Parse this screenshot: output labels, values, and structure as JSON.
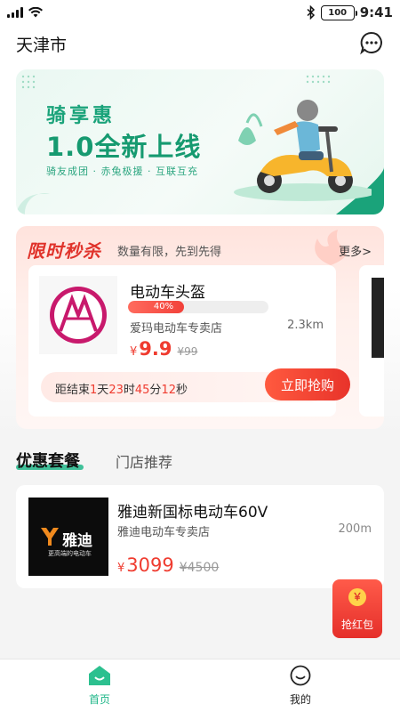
{
  "status_bar": {
    "time": "9:41",
    "battery": "100"
  },
  "header": {
    "city": "天津市"
  },
  "banner": {
    "title": "骑享惠",
    "headline": "1.0全新上线",
    "subtitle": "骑友成团 · 赤兔极援 · 互联互充"
  },
  "flash_sale": {
    "title": "限时秒杀",
    "subtitle": "数量有限，先到先得",
    "more": "更多>",
    "product": {
      "name": "电动车头盔",
      "progress_label": "40%",
      "progress": 0.4,
      "store": "爱玛电动车专卖店",
      "distance": "2.3km",
      "currency": "¥",
      "price": "9.9",
      "old_price": "¥99"
    },
    "countdown": {
      "prefix": "距结束",
      "days": "1",
      "days_unit": "天",
      "hours": "23",
      "hours_unit": "时",
      "minutes": "45",
      "minutes_unit": "分",
      "seconds": "12",
      "seconds_unit": "秒"
    },
    "buy_label": "立即抢购"
  },
  "tabs": [
    {
      "label": "优惠套餐"
    },
    {
      "label": "门店推荐"
    }
  ],
  "package": {
    "name": "雅迪新国标电动车60V",
    "store": "雅迪电动车专卖店",
    "distance": "200m",
    "currency": "¥",
    "price": "3099",
    "old_price": "¥4500",
    "brand": "雅迪",
    "brand_tagline": "更高端的电动车"
  },
  "red_packet": {
    "coin": "￥",
    "label": "抢红包"
  },
  "bottom_nav": [
    {
      "label": "首页",
      "icon": "home-icon",
      "active": true
    },
    {
      "label": "我的",
      "icon": "smile-icon",
      "active": false
    }
  ],
  "colors": {
    "accent": "#20b789",
    "sale_red": "#ef3b2f"
  }
}
